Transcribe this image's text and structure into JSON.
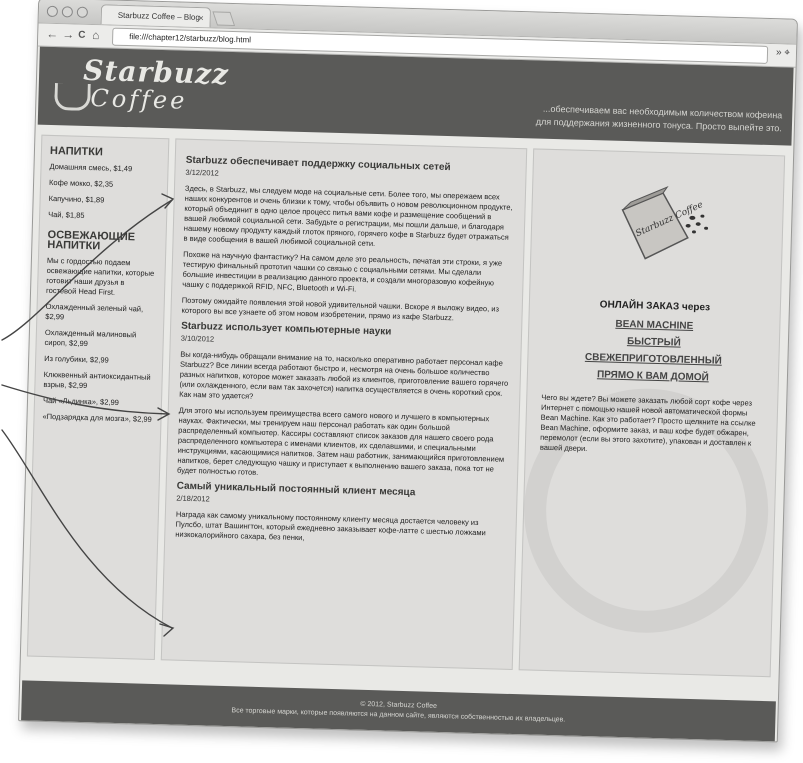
{
  "browser": {
    "tab_title": "Starbuzz Coffee – Blog",
    "tab_close": "×",
    "url": "file:///chapter12/starbuzz/blog.html",
    "nav_back": "←",
    "nav_forward": "→",
    "nav_reload": "C",
    "nav_home": "⌂",
    "toolbar_right": "» ⌖"
  },
  "header": {
    "logo_line1": "Starbuzz",
    "logo_line2": "Coffee",
    "tagline": "...обеспечиваем вас необходимым количеством кофеина для поддержания жизненного тонуса. Просто выпейте это."
  },
  "sidebar": {
    "drinks_heading": "НАПИТКИ",
    "drinks": [
      "Домашняя смесь, $1,49",
      "Кофе мокко, $2,35",
      "Капучино, $1,89",
      "Чай, $1,85"
    ],
    "cool_heading": "ОСВЕЖАЮЩИЕ НАПИТКИ",
    "cool_intro": "Мы с гордостью подаем освежающие напитки, которые готовит наши друзья в гостевой Head First.",
    "cool_items": [
      "Охлажденный зеленый чай, $2,99",
      "Охлажденный малиновый сироп, $2,99",
      "Из голубики, $2,99",
      "Клюквенный антиоксидантный взрыв, $2,99",
      "Чай «Льдинка», $2,99",
      "«Подзарядка для мозга», $2,99"
    ]
  },
  "posts": [
    {
      "title": "Starbuzz обеспечивает поддержку социальных сетей",
      "date": "3/12/2012",
      "paras": [
        "Здесь, в Starbuzz, мы следуем моде на социальные сети. Более того, мы опережаем всех наших конкурентов и очень близки к тому, чтобы объявить о новом революционном продукте, который объединит в одно целое процесс питья вами кофе и размещение сообщений в вашей любимой социальной сети. Забудьте о регистрации, мы пошли дальше, и благодаря нашему новому продукту каждый глоток пряного, горячего кофе в Starbuzz будет отражаться в виде сообщения в вашей любимой социальной сети.",
        "Похоже на научную фантастику? На самом деле это реальность, печатая эти строки, я уже тестирую финальный прототип чашки со связью с социальными сетями. Мы сделали большие инвестиции в реализацию данного проекта, и создали многоразовую кофейную чашку с поддержкой RFID, NFC, Bluetooth и Wi-Fi.",
        "Поэтому ожидайте появления этой новой удивительной чашки. Вскоре я выложу видео, из которого вы все узнаете об этом новом изобретении, прямо из кафе Starbuzz."
      ]
    },
    {
      "title": "Starbuzz использует компьютерные науки",
      "date": "3/10/2012",
      "paras": [
        "Вы когда-нибудь обращали внимание на то, насколько оперативно работает персонал кафе Starbuzz? Все линии всегда работают быстро и, несмотря на очень большое количество разных напитков, которое может заказать любой из клиентов, приготовление вашего горячего (или охлажденного, если вам так захочется) напитка осуществляется в очень короткий срок. Как нам это удается?",
        "Для этого мы используем преимущества всего самого нового и лучшего в компьютерных науках. Фактически, мы тренируем наш персонал работать как один большой распределенный компьютер. Кассиры составляют список заказов для нашего своего рода распределенного компьютера с именами клиентов, их сделавшими, и специальными инструкциями, касающимися напитков. Затем наш работник, занимающийся приготовлением напитков, берет следующую чашку и приступает к выполнению вашего заказа, пока тот не будет полностью готов."
      ]
    },
    {
      "title": "Самый уникальный постоянный клиент месяца",
      "date": "2/18/2012",
      "paras": [
        "Награда как самому уникальному постоянному клиенту месяца достается человеку из Пулсбо, штат Вашингтон, который ежедневно заказывает кофе-латте с шестью ложками низкокалорийного сахара, без пенки,"
      ]
    }
  ],
  "order": {
    "bag_label": "Starbuzz Coffee",
    "heading": "ОНЛАЙН ЗАКАЗ через",
    "links": [
      "BEAN MACHINE",
      "БЫСТРЫЙ",
      "СВЕЖЕПРИГОТОВЛЕННЫЙ",
      "ПРЯМО К ВАМ ДОМОЙ"
    ],
    "text": "Чего вы ждете? Вы можете заказать любой сорт кофе через Интернет с помощью нашей новой автоматической формы Bean Machine. Как это работает? Просто щелкните на ссылке Bean Machine, оформите заказ, и ваш кофе будет обжарен, перемолот (если вы этого захотите), упакован и доставлен к вашей двери."
  },
  "footer": {
    "copyright": "© 2012, Starbuzz Coffee",
    "rights": "Все торговые марки, которые появляются на данном сайте, являются собственностью их владельцев."
  }
}
